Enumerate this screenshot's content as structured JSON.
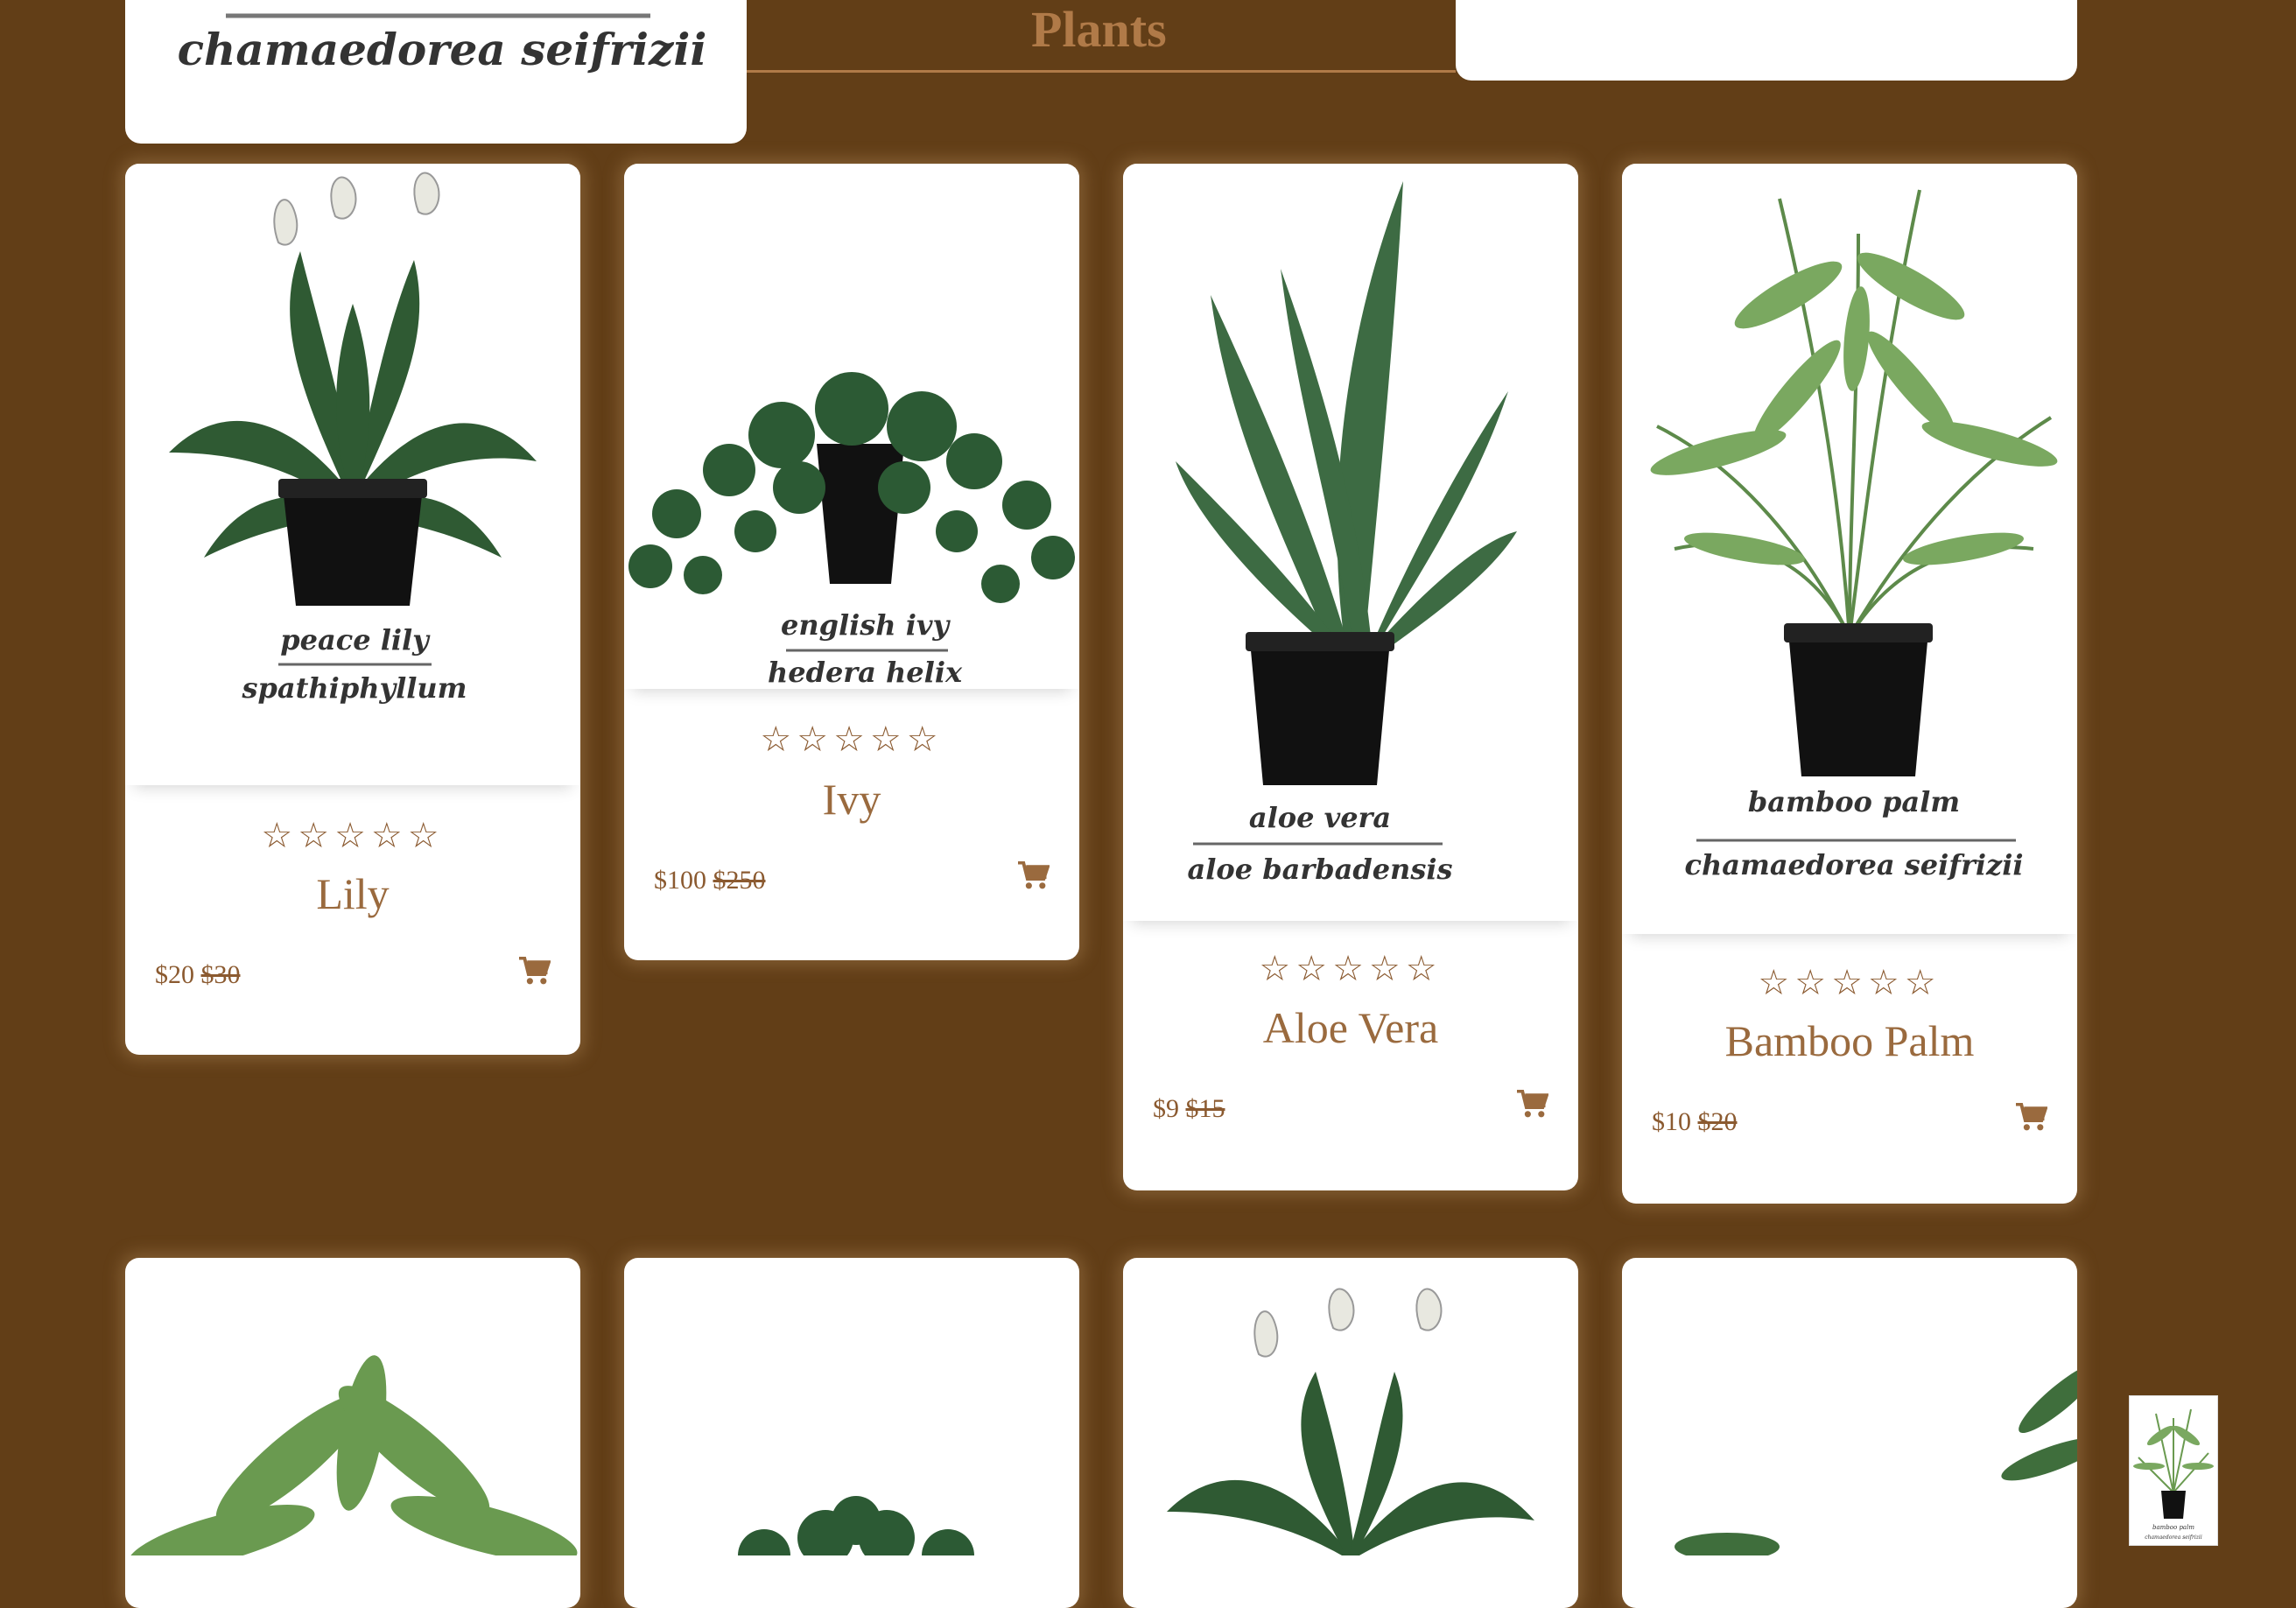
{
  "header": {
    "title": "Plants",
    "featured_caption": "chamaedorea seifrizii"
  },
  "colors": {
    "background": "#623e17",
    "accent": "#9a6a3e",
    "card": "#ffffff"
  },
  "products": [
    {
      "name": "Lily",
      "price": "$20",
      "original_price": "$30",
      "rating": 0,
      "max_rating": 5,
      "stars": "☆☆☆☆☆",
      "caption_top": "peace lily",
      "caption_bottom": "spathiphyllum",
      "icon": "cart-icon"
    },
    {
      "name": "Ivy",
      "price": "$100",
      "original_price": "$250",
      "rating": 0,
      "max_rating": 5,
      "stars": "☆☆☆☆☆",
      "caption_top": "english ivy",
      "caption_bottom": "hedera helix",
      "icon": "cart-icon"
    },
    {
      "name": "Aloe Vera",
      "price": "$9",
      "original_price": "$15",
      "rating": 0,
      "max_rating": 5,
      "stars": "☆☆☆☆☆",
      "caption_top": "aloe vera",
      "caption_bottom": "aloe barbadensis",
      "icon": "cart-icon"
    },
    {
      "name": "Bamboo Palm",
      "price": "$10",
      "original_price": "$20",
      "rating": 0,
      "max_rating": 5,
      "stars": "☆☆☆☆☆",
      "caption_top": "bamboo palm",
      "caption_bottom": "chamaedorea seifrizii",
      "icon": "cart-icon"
    }
  ],
  "thumbnail": {
    "caption_top": "bamboo palm",
    "caption_bottom": "chamaedorea seifrizii"
  }
}
